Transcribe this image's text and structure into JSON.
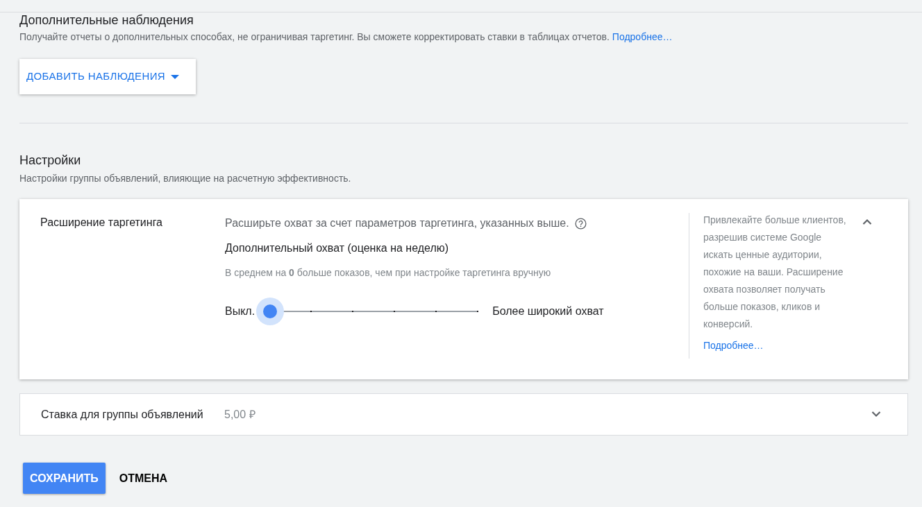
{
  "observations": {
    "title": "Дополнительные наблюдения",
    "description": "Получайте отчеты о дополнительных способах, не ограничивая таргетинг. Вы сможете корректировать ставки в таблицах отчетов.",
    "link": "Подробнее…",
    "button": "ДОБАВИТЬ НАБЛЮДЕНИЯ"
  },
  "settings": {
    "title": "Настройки",
    "description": "Настройки группы объявлений, влияющие на расчетную эффективность.",
    "rows": [
      {
        "label": "Расширение таргетинга",
        "expanded": true,
        "intro": "Расширьте охват за счет параметров таргетинга, указанных выше.",
        "subtitle": "Дополнительный охват (оценка на неделю)",
        "estimate": "В среднем на **0** больше показов, чем при настройке таргетинга вручную",
        "slider": {
          "min_label": "Выкл.",
          "max_label": "Более широкий охват",
          "level": 0
        },
        "help": "Привлекайте больше клиентов, разрешив системе Google искать ценные аудитории, похожие на ваши. Расширение охвата позволяет получать больше показов, кликов и конверсий.",
        "help_link": "Подробнее…"
      },
      {
        "label": "Ставка для группы объявлений",
        "expanded": false,
        "value": "5,00 ₽"
      }
    ]
  },
  "actions": {
    "save": "СОХРАНИТЬ",
    "cancel": "ОТМЕНА"
  }
}
